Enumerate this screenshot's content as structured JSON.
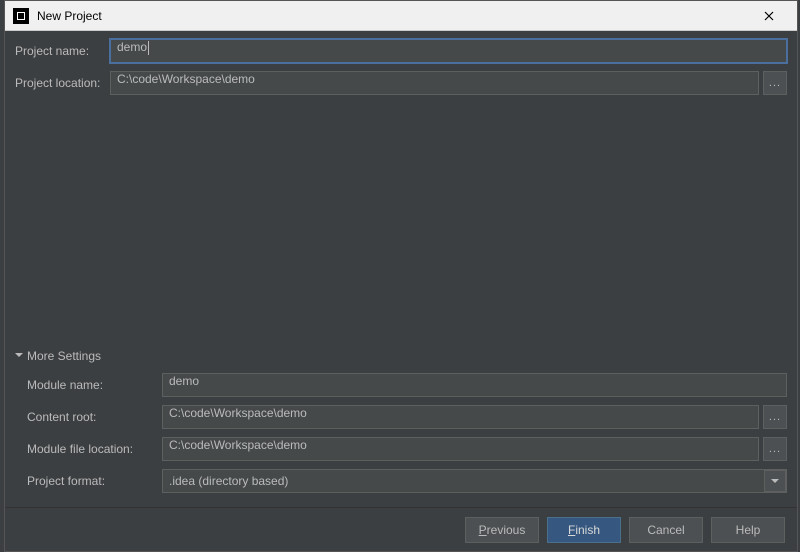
{
  "titlebar": {
    "title": "New Project"
  },
  "form": {
    "project_name_label": "Project name:",
    "project_name_value": "demo",
    "project_location_label": "Project location:",
    "project_location_value": "C:\\code\\Workspace\\demo"
  },
  "more": {
    "header": "More Settings",
    "module_name_label": "Module name:",
    "module_name_value": "demo",
    "content_root_label": "Content root:",
    "content_root_value": "C:\\code\\Workspace\\demo",
    "module_file_label": "Module file location:",
    "module_file_value": "C:\\code\\Workspace\\demo",
    "project_format_label": "Project format:",
    "project_format_value": ".idea (directory based)"
  },
  "buttons": {
    "previous": "Previous",
    "finish": "Finish",
    "cancel": "Cancel",
    "help": "Help"
  },
  "icons": {
    "browse": "..."
  }
}
